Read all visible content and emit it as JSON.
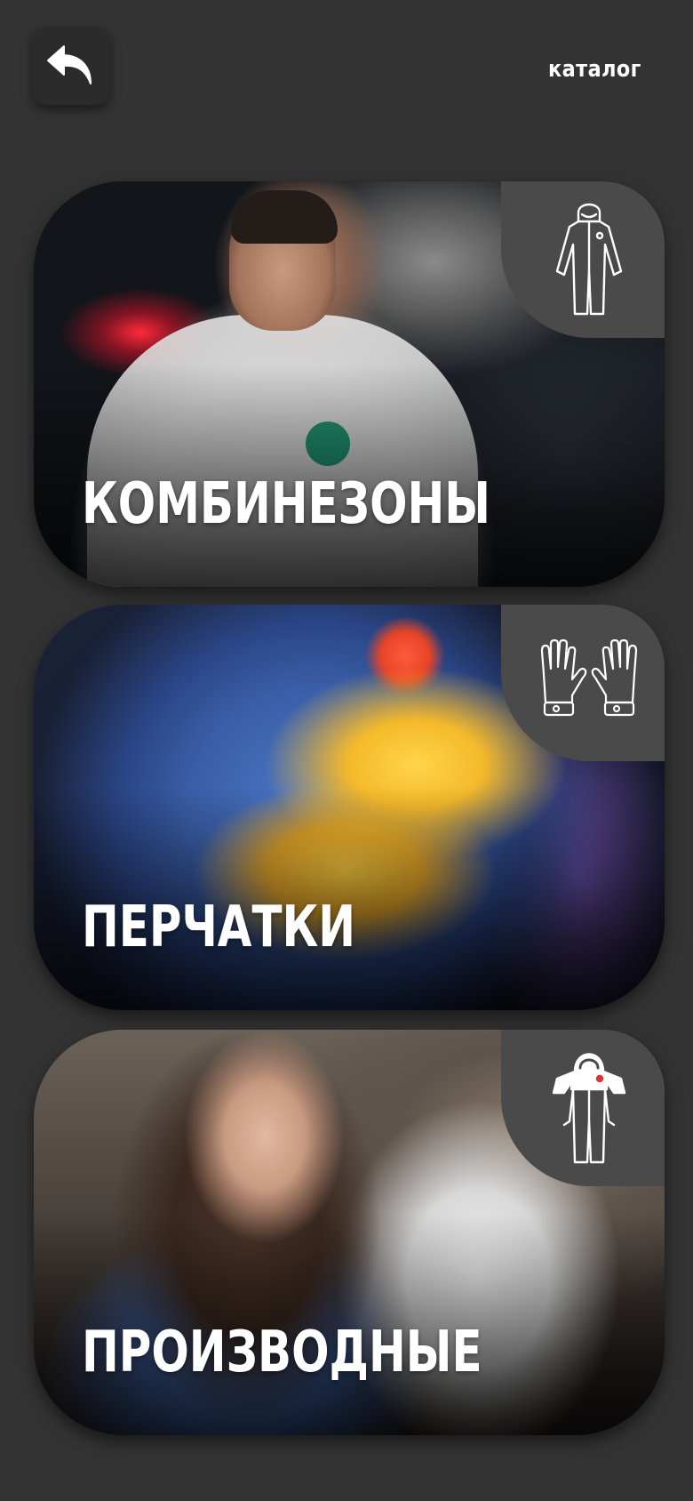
{
  "header": {
    "back_icon": "undo-arrow-icon",
    "title": "каталог"
  },
  "colors": {
    "background": "#333333",
    "back_button_bg": "#2b2b2b",
    "badge_bg": "#4a4a4a",
    "text": "#ffffff"
  },
  "categories": [
    {
      "label": "КОМБИНЕЗОНЫ",
      "icon": "coverall-icon",
      "photo": "man-in-white-coverall-with-safety-glasses"
    },
    {
      "label": "ПЕРЧАТКИ",
      "icon": "gloves-icon",
      "photo": "yellow-rubber-gloves-on-blue-coverall"
    },
    {
      "label": "ПРОИЗВОДНЫЕ",
      "icon": "hooded-coverall-icon",
      "photo": "woman-in-blue-and-white-coverall"
    }
  ]
}
